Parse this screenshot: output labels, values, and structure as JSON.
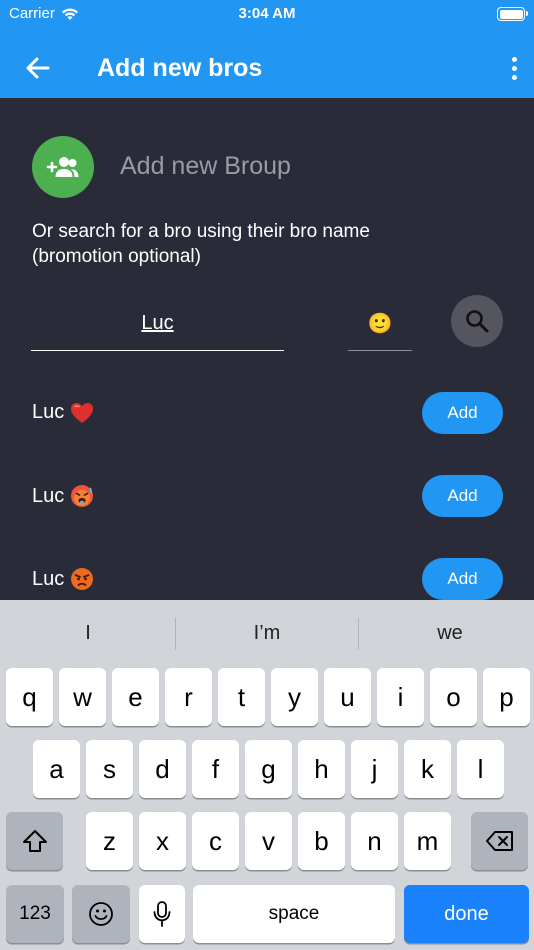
{
  "status": {
    "carrier": "Carrier",
    "time": "3:04 AM"
  },
  "appbar": {
    "title": "Add new bros"
  },
  "group": {
    "label": "Add new Broup"
  },
  "search": {
    "hint": "Or search for a bro using their bro name (bromotion optional)",
    "name_value": "Luc",
    "emoji_value": "🙂"
  },
  "results": [
    {
      "name": "Luc",
      "emoji": "heart",
      "button": "Add"
    },
    {
      "name": "Luc",
      "emoji": "hot-face",
      "button": "Add"
    },
    {
      "name": "Luc",
      "emoji": "angry-face",
      "button": "Add"
    }
  ],
  "keyboard": {
    "suggestions": [
      "I",
      "I’m",
      "we"
    ],
    "row1": [
      "q",
      "w",
      "e",
      "r",
      "t",
      "y",
      "u",
      "i",
      "o",
      "p"
    ],
    "row2": [
      "a",
      "s",
      "d",
      "f",
      "g",
      "h",
      "j",
      "k",
      "l"
    ],
    "row3": [
      "z",
      "x",
      "c",
      "v",
      "b",
      "n",
      "m"
    ],
    "numbers": "123",
    "space": "space",
    "done": "done"
  },
  "colors": {
    "appbar": "#2196f3",
    "background": "#2a2b38",
    "group_button": "#4caf50",
    "add_button": "#2196f3",
    "done_key": "#1a82fb"
  }
}
